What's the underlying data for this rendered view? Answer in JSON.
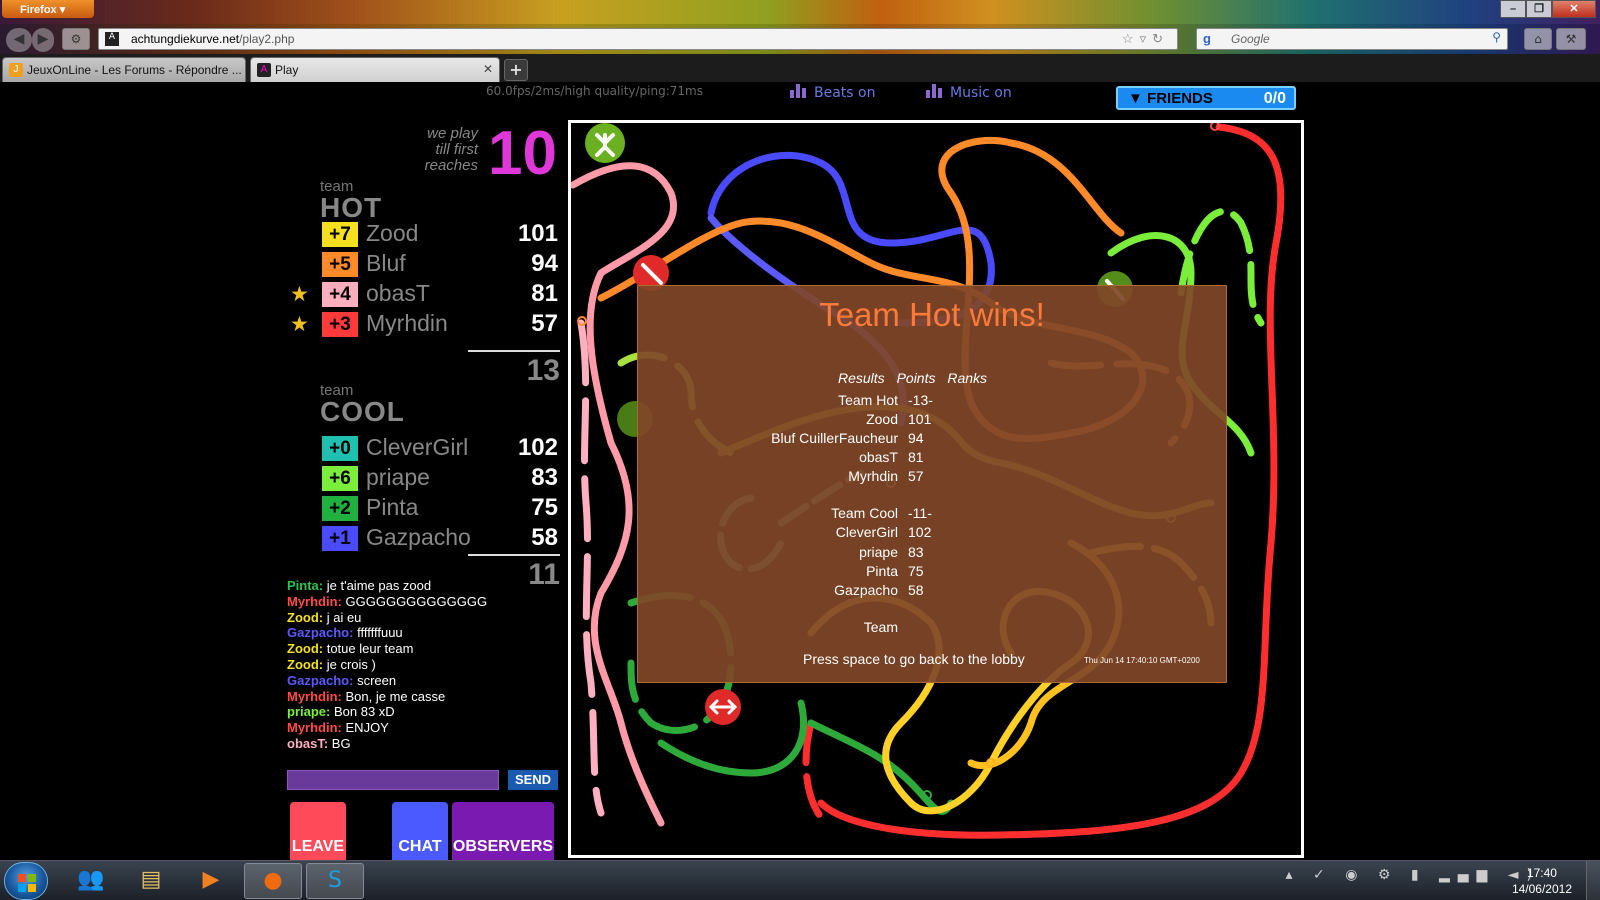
{
  "browser": {
    "menu_label": "Firefox",
    "url_host": "achtungdiekurve.net",
    "url_path": "/play2.php",
    "search_placeholder": "Google",
    "tabs": [
      {
        "label": "JeuxOnLine - Les Forums - Répondre ..."
      },
      {
        "label": "Play"
      }
    ],
    "new_tab_label": "+"
  },
  "topbar": {
    "stats": "60.0fps/2ms/high quality/ping:71ms",
    "beats_label": "Beats on",
    "music_label": "Music on",
    "friends_label": "FRIENDS",
    "friends_count": "0/0"
  },
  "goal": {
    "text_line1": "we play",
    "text_line2": "till first",
    "text_line3": "reaches",
    "target": "10"
  },
  "teams": [
    {
      "label": "team",
      "name": "HOT",
      "total": "13",
      "players": [
        {
          "delta": "+7",
          "name": "Zood",
          "score": "101",
          "color": "#f5e020",
          "star": false
        },
        {
          "delta": "+5",
          "name": "Bluf",
          "score": "94",
          "color": "#ff8a2a",
          "star": false
        },
        {
          "delta": "+4",
          "name": "obasT",
          "score": "81",
          "color": "#ffaec0",
          "star": true
        },
        {
          "delta": "+3",
          "name": "Myrhdin",
          "score": "57",
          "color": "#ff3a3a",
          "star": true
        }
      ]
    },
    {
      "label": "team",
      "name": "COOL",
      "total": "11",
      "players": [
        {
          "delta": "+0",
          "name": "CleverGirl",
          "score": "102",
          "color": "#20c0b0",
          "star": false
        },
        {
          "delta": "+6",
          "name": "priape",
          "score": "83",
          "color": "#7aee3a",
          "star": false
        },
        {
          "delta": "+2",
          "name": "Pinta",
          "score": "75",
          "color": "#20b040",
          "star": false
        },
        {
          "delta": "+1",
          "name": "Gazpacho",
          "score": "58",
          "color": "#4a4aff",
          "star": false
        }
      ]
    }
  ],
  "chat": [
    {
      "who": "Pinta:",
      "msg": "je t'aime pas zood",
      "color": "#2ec050"
    },
    {
      "who": "Myrhdin:",
      "msg": "GGGGGGGGGGGGGG",
      "color": "#ff4a4a"
    },
    {
      "who": "Zood:",
      "msg": "j ai eu",
      "color": "#f5e020"
    },
    {
      "who": "Gazpacho:",
      "msg": "fffffffuuu",
      "color": "#5a5aff"
    },
    {
      "who": "Zood:",
      "msg": "totue leur team",
      "color": "#f5e020"
    },
    {
      "who": "Zood:",
      "msg": "je crois )",
      "color": "#f5e020"
    },
    {
      "who": "Gazpacho:",
      "msg": "screen",
      "color": "#5a5aff"
    },
    {
      "who": "Myrhdin:",
      "msg": "Bon, je me casse",
      "color": "#ff4a4a"
    },
    {
      "who": "priape:",
      "msg": "Bon 83 xD",
      "color": "#7aee3a"
    },
    {
      "who": "Myrhdin:",
      "msg": "ENJOY",
      "color": "#ff4a4a"
    },
    {
      "who": "obasT:",
      "msg": "BG",
      "color": "#ffaec0"
    }
  ],
  "chat_send_label": "SEND",
  "buttons": {
    "leave": "LEAVE",
    "chat": "CHAT",
    "observers": "OBSERVERS"
  },
  "results": {
    "title": "Team Hot wins!",
    "header": "Results Points Ranks",
    "rows": [
      {
        "name": "Team Hot",
        "value": "-13-"
      },
      {
        "name": "Zood",
        "value": "101"
      },
      {
        "name": "Bluf CuillerFaucheur",
        "value": "94"
      },
      {
        "name": "obasT",
        "value": "81"
      },
      {
        "name": "Myrhdin",
        "value": "57"
      },
      {
        "name": "Team Cool",
        "value": "-11-"
      },
      {
        "name": "CleverGirl",
        "value": "102"
      },
      {
        "name": "priape",
        "value": "83"
      },
      {
        "name": "Pinta",
        "value": "75"
      },
      {
        "name": "Gazpacho",
        "value": "58"
      },
      {
        "name": "Team",
        "value": ""
      }
    ],
    "press": "Press space to go back to the lobby",
    "date": "Thu Jun 14 17:40:10 GMT+0200"
  },
  "taskbar": {
    "time": "17:40",
    "date": "14/06/2012"
  }
}
